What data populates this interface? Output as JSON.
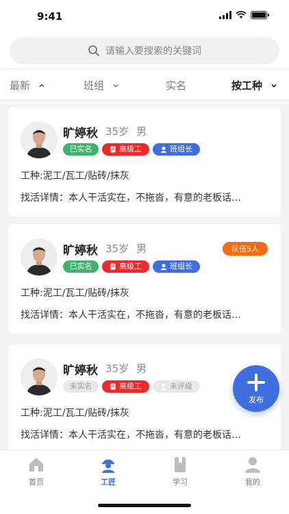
{
  "status_bar": {
    "time": "9:41"
  },
  "search": {
    "placeholder": "请输入要搜索的关键词"
  },
  "filters": [
    {
      "label": "最新",
      "arrow": "up"
    },
    {
      "label": "班组",
      "arrow": "down"
    },
    {
      "label": "实名",
      "arrow": ""
    },
    {
      "label": "按工种",
      "arrow": "down",
      "active": true
    }
  ],
  "workers": [
    {
      "name": "旷婷秋",
      "age": "35岁",
      "gender": "男",
      "verify": "已实名",
      "level": "高级工",
      "role": "班组长",
      "team": "",
      "trade": "工种:泥工/瓦工/贴砖/抹灰",
      "detail": "找活详情：本人干活实在，不拖沓，有意的老板话…"
    },
    {
      "name": "旷婷秋",
      "age": "35岁",
      "gender": "男",
      "verify": "已实名",
      "level": "高级工",
      "role": "班组长",
      "team": "队伍5人",
      "trade": "工种:泥工/瓦工/贴砖/抹灰",
      "detail": "找活详情：本人干活实在，不拖沓，有意的老板话…"
    },
    {
      "name": "旷婷秋",
      "age": "35岁",
      "gender": "男",
      "verify": "未实名",
      "level": "高级工",
      "role": "未评级",
      "team": "",
      "trade": "工种:泥工/瓦工/贴砖/抹灰",
      "detail": "找活详情：本人干活实在，不拖沓，有意的老板话…"
    }
  ],
  "fab": {
    "label": "发布",
    "icon": "plus-icon"
  },
  "tabs": [
    {
      "label": "首页",
      "icon": "home-icon"
    },
    {
      "label": "工匠",
      "icon": "worker-icon",
      "active": true
    },
    {
      "label": "学习",
      "icon": "book-icon"
    },
    {
      "label": "我的",
      "icon": "user-icon"
    }
  ],
  "colors": {
    "accent": "#3e6ee0",
    "verified": "#3fb36c",
    "senior": "#ec2a2a",
    "team": "#f46d12"
  }
}
